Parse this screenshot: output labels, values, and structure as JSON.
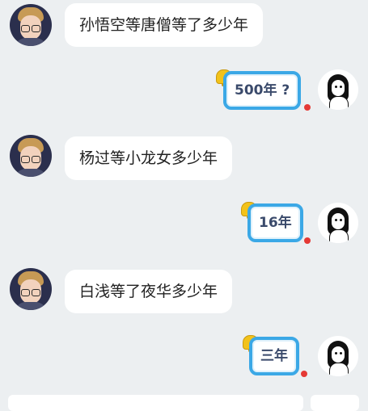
{
  "messages": [
    {
      "side": "left",
      "text": "孙悟空等唐僧等了多少年"
    },
    {
      "side": "right",
      "text": "500年 ?"
    },
    {
      "side": "left",
      "text": "杨过等小龙女多少年"
    },
    {
      "side": "right",
      "text": "16年"
    },
    {
      "side": "left",
      "text": "白浅等了夜华多少年"
    },
    {
      "side": "right",
      "text": "三年"
    }
  ],
  "colors": {
    "background": "#eceff1",
    "bubble_left": "#ffffff",
    "bubble_right_border": "#3ba8e6",
    "bubble_right_text": "#3a4a6b",
    "bell": "#f2c21a",
    "unread_dot": "#e53935"
  }
}
